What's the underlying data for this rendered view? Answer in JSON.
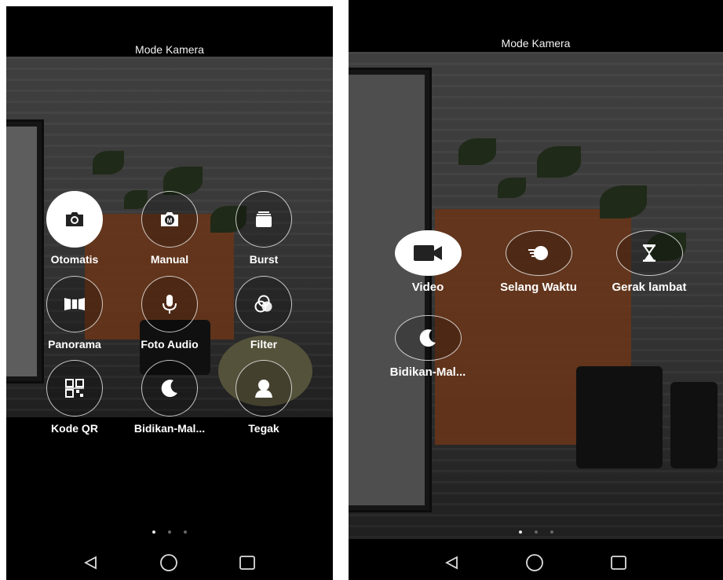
{
  "screens": [
    {
      "title": "Mode Kamera",
      "modes": [
        {
          "label": "Otomatis",
          "icon": "camera-icon",
          "selected": true
        },
        {
          "label": "Manual",
          "icon": "manual-camera-icon",
          "selected": false
        },
        {
          "label": "Burst",
          "icon": "burst-icon",
          "selected": false
        },
        {
          "label": "Panorama",
          "icon": "panorama-icon",
          "selected": false
        },
        {
          "label": "Foto Audio",
          "icon": "microphone-icon",
          "selected": false
        },
        {
          "label": "Filter",
          "icon": "filter-icon",
          "selected": false
        },
        {
          "label": "Kode QR",
          "icon": "qr-code-icon",
          "selected": false
        },
        {
          "label": "Bidikan-Mal...",
          "icon": "moon-icon",
          "selected": false
        },
        {
          "label": "Tegak",
          "icon": "portrait-icon",
          "selected": false
        }
      ],
      "page_dots": {
        "count": 3,
        "active": 1
      }
    },
    {
      "title": "Mode Kamera",
      "modes": [
        {
          "label": "Video",
          "icon": "video-icon",
          "selected": true
        },
        {
          "label": "Selang Waktu",
          "icon": "timelapse-icon",
          "selected": false
        },
        {
          "label": "Gerak lambat",
          "icon": "hourglass-icon",
          "selected": false
        },
        {
          "label": "Bidikan-Mal...",
          "icon": "moon-icon",
          "selected": false
        }
      ],
      "page_dots": {
        "count": 3,
        "active": 1
      }
    }
  ],
  "navbar": {
    "icons": [
      "back-icon",
      "home-icon",
      "recents-icon"
    ]
  },
  "colors": {
    "background": "#000000",
    "selected_circle": "#ffffff",
    "text": "#ffffff",
    "planter": "#6a3518"
  }
}
